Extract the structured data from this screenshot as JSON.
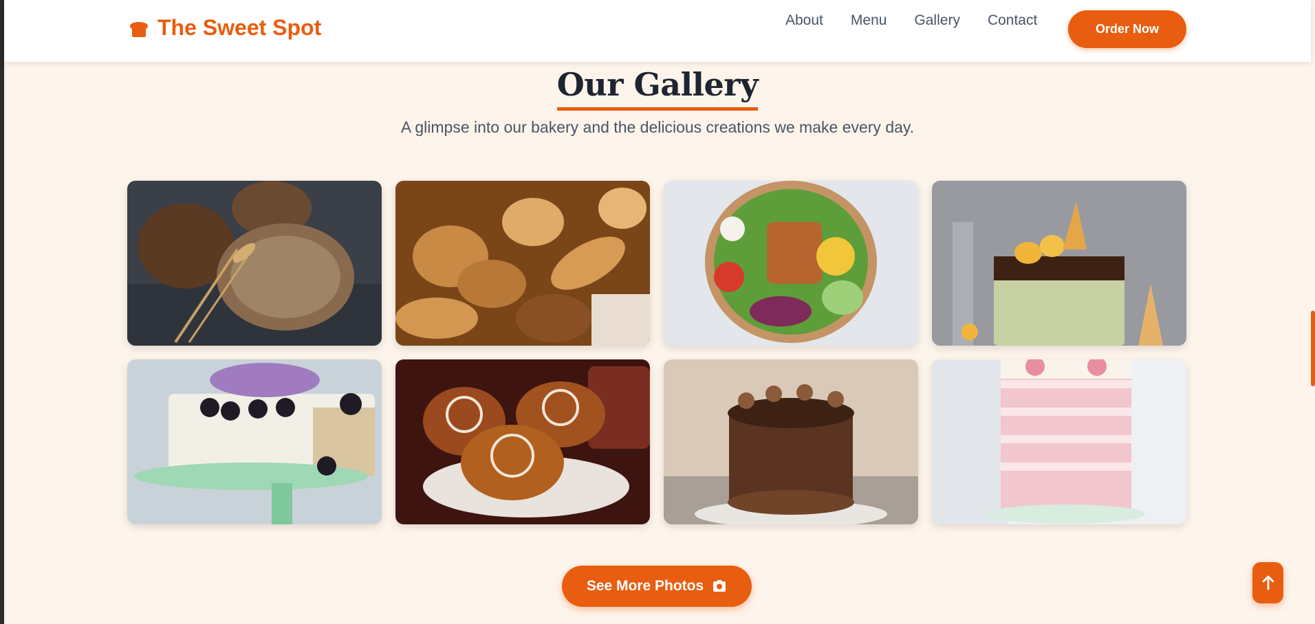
{
  "brand": {
    "name": "The Sweet Spot",
    "icon": "bread-icon"
  },
  "nav": {
    "items": [
      {
        "label": "About"
      },
      {
        "label": "Menu"
      },
      {
        "label": "Gallery"
      },
      {
        "label": "Contact"
      }
    ],
    "cta_label": "Order Now"
  },
  "gallery": {
    "title": "Our Gallery",
    "subtitle": "A glimpse into our bakery and the delicious creations we make every day.",
    "photos": [
      {
        "subject": "rustic seeded bread loaves with wheat"
      },
      {
        "subject": "assorted bread rolls and baguettes"
      },
      {
        "subject": "salad bowl with grilled chicken"
      },
      {
        "subject": "chocolate drip cake with macarons"
      },
      {
        "subject": "white cake with blackberries and lilac flowers"
      },
      {
        "subject": "glazed cinnamon rolls"
      },
      {
        "subject": "chocolate frosted cake"
      },
      {
        "subject": "pink striped drip cake"
      }
    ],
    "more_label": "See More Photos",
    "more_icon": "camera-icon"
  },
  "scroll_top_icon": "arrow-up-icon",
  "colors": {
    "accent": "#e85d0f",
    "background": "#fdf4eb",
    "heading": "#1e2430",
    "text": "#4a5565"
  }
}
